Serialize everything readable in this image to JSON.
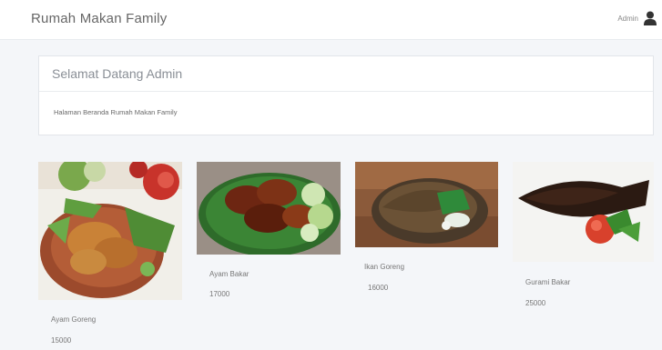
{
  "navbar": {
    "brand": "Rumah Makan Family",
    "user_name": "Admin",
    "user_icon": "user-icon"
  },
  "welcome": {
    "title": "Selamat Datang Admin",
    "text": "Halaman Beranda Rumah Makan Family"
  },
  "menu": [
    {
      "name": "Ayam Goreng",
      "price": "15000",
      "image": "fried-chicken-photo"
    },
    {
      "name": "Ayam Bakar",
      "price": "17000",
      "image": "grilled-chicken-photo"
    },
    {
      "name": "Ikan Goreng",
      "price": "16000",
      "image": "fried-fish-photo"
    },
    {
      "name": "Gurami Bakar",
      "price": "25000",
      "image": "grilled-gourami-photo"
    }
  ]
}
